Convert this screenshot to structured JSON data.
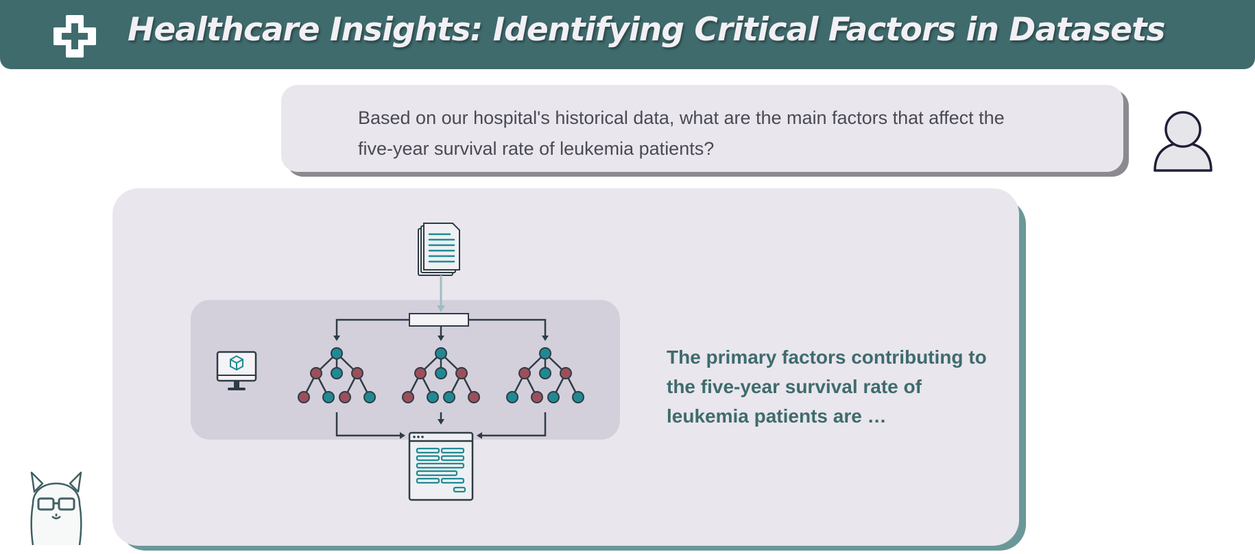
{
  "header": {
    "title": "Healthcare Insights: Identifying Critical Factors in Datasets"
  },
  "question": {
    "text": "Based on our hospital's historical data, what are the main factors that affect the five-year survival rate of leukemia patients?"
  },
  "answer": {
    "text": "The primary factors contributing to the five-year survival rate of leukemia patients are …"
  },
  "icons": {
    "header": "medical-cross-icon",
    "user": "user-icon",
    "documents": "document-stack-icon",
    "computer": "computer-monitor-icon",
    "result": "result-window-icon",
    "assistant": "llama-avatar-icon"
  },
  "colors": {
    "brand": "#3f6b6d",
    "panel": "#e9e6ed",
    "panel_shadow": "#6a9899",
    "pipeline_box": "#d3d0dc",
    "node_teal": "#1f8a93",
    "node_red": "#9c4f5a"
  }
}
